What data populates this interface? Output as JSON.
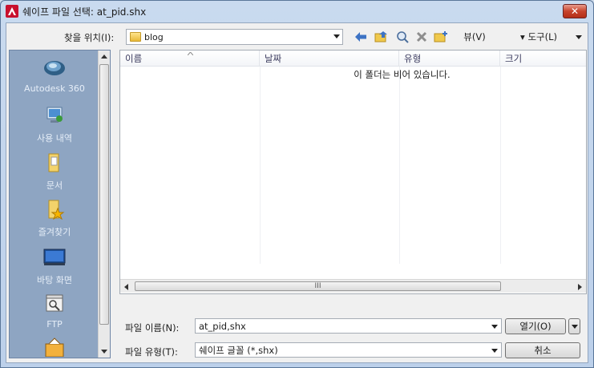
{
  "window": {
    "title": "쉐이프 파일 선택: at_pid.shx",
    "close_label": "✕"
  },
  "lookin": {
    "label": "찾을 위치(I):",
    "value": "blog"
  },
  "toolbar": {
    "views_label": "뷰(V)",
    "tools_label": "▾ 도구(L)"
  },
  "places": [
    {
      "label": "Autodesk 360",
      "icon": "cloud-icon"
    },
    {
      "label": "사용 내역",
      "icon": "history-icon"
    },
    {
      "label": "문서",
      "icon": "documents-icon"
    },
    {
      "label": "즐겨찾기",
      "icon": "favorites-icon"
    },
    {
      "label": "바탕 화면",
      "icon": "desktop-icon"
    },
    {
      "label": "FTP",
      "icon": "ftp-icon"
    },
    {
      "label": "",
      "icon": "buzzsaw-icon"
    }
  ],
  "filelist": {
    "columns": [
      "이름",
      "날짜",
      "유형",
      "크기"
    ],
    "empty_message": "이 폴더는 비어 있습니다.",
    "hscroll_grip": "III"
  },
  "filename": {
    "label": "파일 이름(N):",
    "value": "at_pid,shx"
  },
  "filetype": {
    "label": "파일 유형(T):",
    "value": "쉐이프 글꼴 (*,shx)"
  },
  "buttons": {
    "open": "열기(O)",
    "cancel": "취소"
  }
}
